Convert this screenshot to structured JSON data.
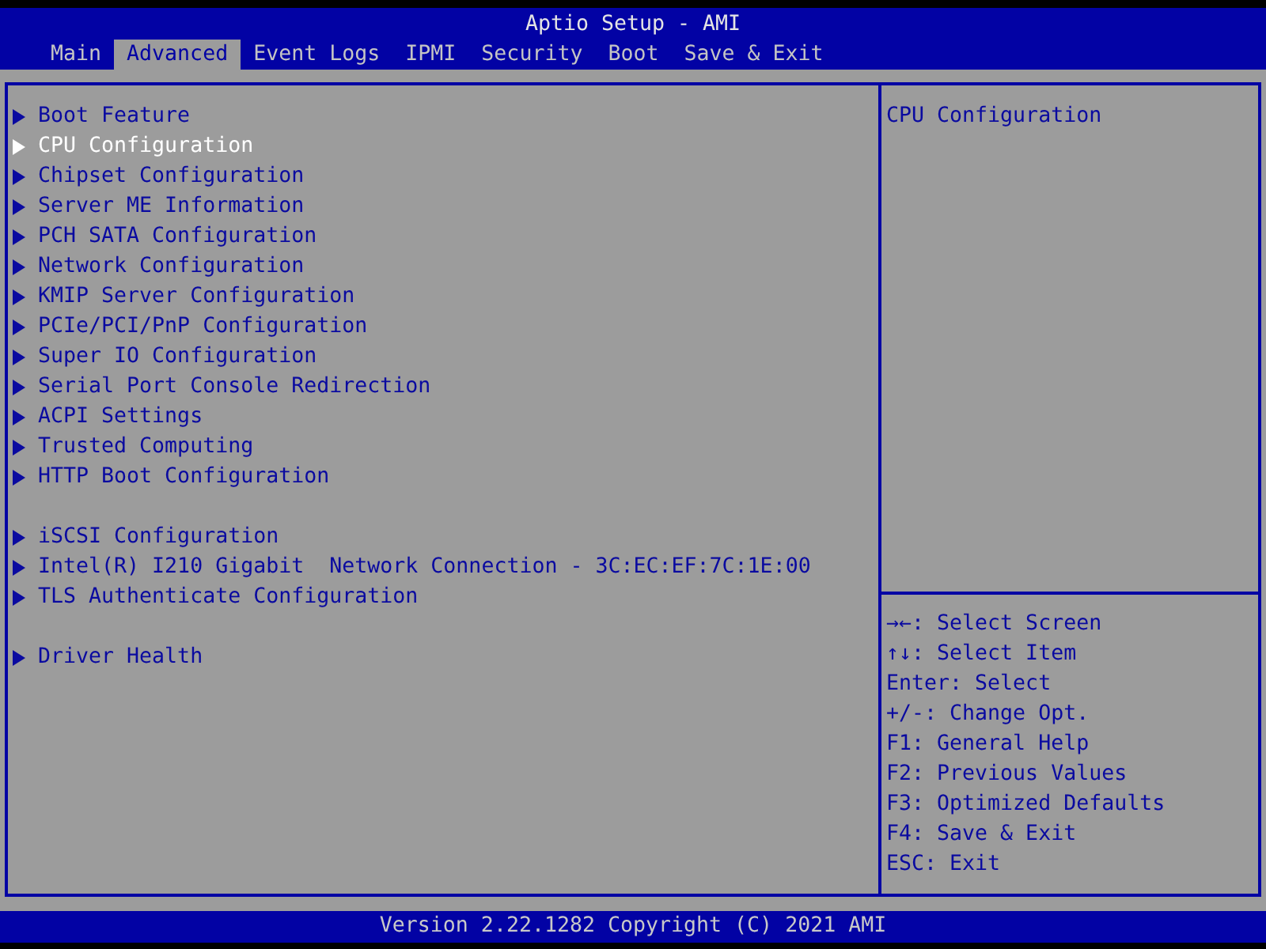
{
  "window": {
    "title": "Aptio Setup - AMI"
  },
  "tabs": [
    {
      "label": "Main",
      "selected": false
    },
    {
      "label": "Advanced",
      "selected": true
    },
    {
      "label": "Event Logs",
      "selected": false
    },
    {
      "label": "IPMI",
      "selected": false
    },
    {
      "label": "Security",
      "selected": false
    },
    {
      "label": "Boot",
      "selected": false
    },
    {
      "label": "Save & Exit",
      "selected": false
    }
  ],
  "menu": {
    "groups": [
      {
        "items": [
          {
            "label": "Boot Feature",
            "selected": false
          },
          {
            "label": "CPU Configuration",
            "selected": true
          },
          {
            "label": "Chipset Configuration",
            "selected": false
          },
          {
            "label": "Server ME Information",
            "selected": false
          },
          {
            "label": "PCH SATA Configuration",
            "selected": false
          },
          {
            "label": "Network Configuration",
            "selected": false
          },
          {
            "label": "KMIP Server Configuration",
            "selected": false
          },
          {
            "label": "PCIe/PCI/PnP Configuration",
            "selected": false
          },
          {
            "label": "Super IO Configuration",
            "selected": false
          },
          {
            "label": "Serial Port Console Redirection",
            "selected": false
          },
          {
            "label": "ACPI Settings",
            "selected": false
          },
          {
            "label": "Trusted Computing",
            "selected": false
          },
          {
            "label": "HTTP Boot Configuration",
            "selected": false
          }
        ]
      },
      {
        "items": [
          {
            "label": "iSCSI Configuration",
            "selected": false
          },
          {
            "label": "Intel(R) I210 Gigabit  Network Connection - 3C:EC:EF:7C:1E:00",
            "selected": false
          },
          {
            "label": "TLS Authenticate Configuration",
            "selected": false
          }
        ]
      },
      {
        "items": [
          {
            "label": "Driver Health",
            "selected": false
          }
        ]
      }
    ]
  },
  "help": {
    "description": "CPU Configuration",
    "keys": [
      "→←: Select Screen",
      "↑↓: Select Item",
      "Enter: Select",
      "+/-: Change Opt.",
      "F1: General Help",
      "F2: Previous Values",
      "F3: Optimized Defaults",
      "F4: Save & Exit",
      "ESC: Exit"
    ]
  },
  "status_bar": {
    "text": "Version 2.22.1282 Copyright (C) 2021 AMI"
  }
}
